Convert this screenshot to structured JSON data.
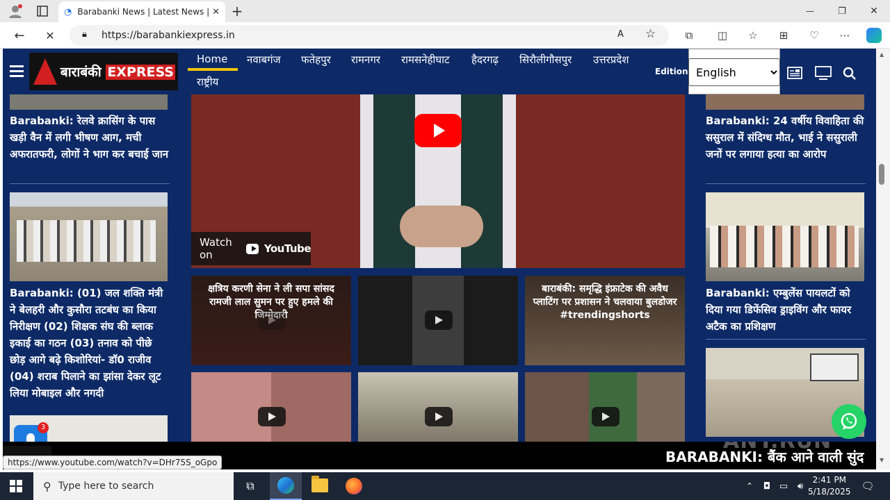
{
  "browser": {
    "tab_title": "Barabanki News | Latest News | Li",
    "url": "https://barabankiexpress.in",
    "new_tab": "+",
    "minimize": "—",
    "restore": "❐",
    "close": "✕"
  },
  "site": {
    "logo_text_hi": "बाराबंकी",
    "logo_text_en": "EXPRESS",
    "nav": [
      {
        "label": "Home"
      },
      {
        "label": "नवाबगंज"
      },
      {
        "label": "फतेहपुर"
      },
      {
        "label": "रामनगर"
      },
      {
        "label": "रामसनेहीघाट"
      },
      {
        "label": "हैदरगढ़"
      },
      {
        "label": "सिरौलीगौसपुर"
      },
      {
        "label": "उत्तरप्रदेश"
      },
      {
        "label": "राष्ट्रीय"
      }
    ],
    "edition_label": "Edition",
    "language_selected": "English",
    "language_options": [
      "English"
    ]
  },
  "left_column": {
    "items": [
      {
        "title": "Barabanki: रेलवे क्रासिंग के पास खड़ी वैन में लगी भीषण आग, मची अफरातफरी, लोगों ने भाग कर बचाई जान"
      },
      {
        "title": "Barabanki: (01) जल शक्ति मंत्री ने बेलहरी और कुसौरा तटबंध का किया निरीक्षण (02) शिक्षक संघ की ब्लाक इकाई का गठन (03) तनाव को पीछे छोड़ आगे बढ़े किशोरियां- डॉ0 राजीव (04) शराब पिलाने का झांसा देकर लूट लिया मोबाइल और नगदी"
      }
    ]
  },
  "right_column": {
    "items": [
      {
        "title": "Barabanki: 24 वर्षीय विवाहिता की ससुराल में संदिग्ध मौत, भाई ने ससुराली जनों पर लगाया हत्या का आरोप"
      },
      {
        "title": "Barabanki: एम्बुलेंस पायलटों को दिया गया डिफेंसिव ड्राइविंग और फायर अटैक का प्रशिक्षण"
      }
    ]
  },
  "video": {
    "watch_on": "Watch on",
    "youtube": "YouTube"
  },
  "shorts": [
    {
      "caption": "क्षत्रिय करणी सेना ने ली सपा सांसद रामजी लाल सुमन पर हुए हमले की जिम्मेदारी"
    },
    {
      "caption": ""
    },
    {
      "caption": "बाराबंकी: समृद्धि इंफ्राटेक की अवैध प्लाटिंग पर प्रशासन ने चलवाया बुलडोजर #trendingshorts"
    },
    {
      "caption": ""
    },
    {
      "caption": ""
    },
    {
      "caption": ""
    }
  ],
  "ticker": {
    "text": "BARABANKI: बैंक आने वाली सुंद"
  },
  "status_url": "https://www.youtube.com/watch?v=DHr75S_oGpo",
  "notification_count": "3",
  "watermark": "ANY.RUN",
  "taskbar": {
    "search_placeholder": "Type here to search",
    "time": "2:41 PM",
    "date": "5/18/2025"
  },
  "colors": {
    "site_bg": "#0d2a67",
    "accent": "#f5c400",
    "youtube_red": "#ff0000"
  }
}
